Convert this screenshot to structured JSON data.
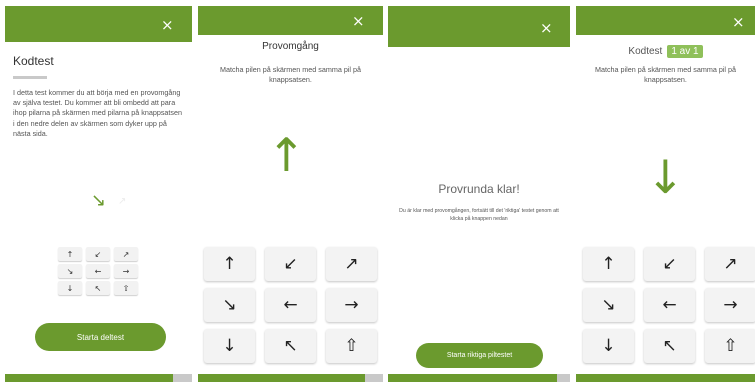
{
  "panel1": {
    "close_icon": "×",
    "title": "Kodtest",
    "body": "I detta test kommer du att börja med en provomgång av själva testet. Du kommer att bli ombedd att para ihop pilarna på skärmen med pilarna på knappsatsen i den nedre delen av skärmen som dyker upp på nästa sida.",
    "target_arrow": "↘",
    "mini_keys": [
      "↑",
      "↙",
      "↗",
      "↘",
      "←",
      "→",
      "↓",
      "↖",
      "⇧"
    ],
    "start_button": "Starta deltest",
    "progress": 0.9
  },
  "panel2": {
    "close_icon": "×",
    "title": "Provomgång",
    "instruction": "Matcha pilen på skärmen med samma pil på knappsatsen.",
    "target_arrow": "↑",
    "keys": [
      "↑",
      "↙",
      "↗",
      "↘",
      "←",
      "→",
      "↓",
      "↖",
      "⇧"
    ],
    "progress": 0.9
  },
  "panel3": {
    "close_icon": "×",
    "title": "Provrunda klar!",
    "subtitle": "Du är klar med provomgången, fortsätt till det 'riktiga' testet genom att klicka på knappen nedan",
    "button": "Starta riktiga piltestet",
    "progress": 0.93
  },
  "panel4": {
    "close_icon": "×",
    "title": "Kodtest",
    "badge": "1 av 1",
    "instruction": "Matcha pilen på skärmen med samma pil på knappsatsen.",
    "target_arrow": "↓",
    "keys": [
      "↑",
      "↙",
      "↗",
      "↘",
      "←",
      "→",
      "↓",
      "↖",
      "⇧"
    ],
    "progress": 1.0
  },
  "colors": {
    "accent": "#6b9a2e",
    "badge": "#8fc05a",
    "key_bg": "#f3f3f3",
    "track": "#c9c9c9"
  }
}
